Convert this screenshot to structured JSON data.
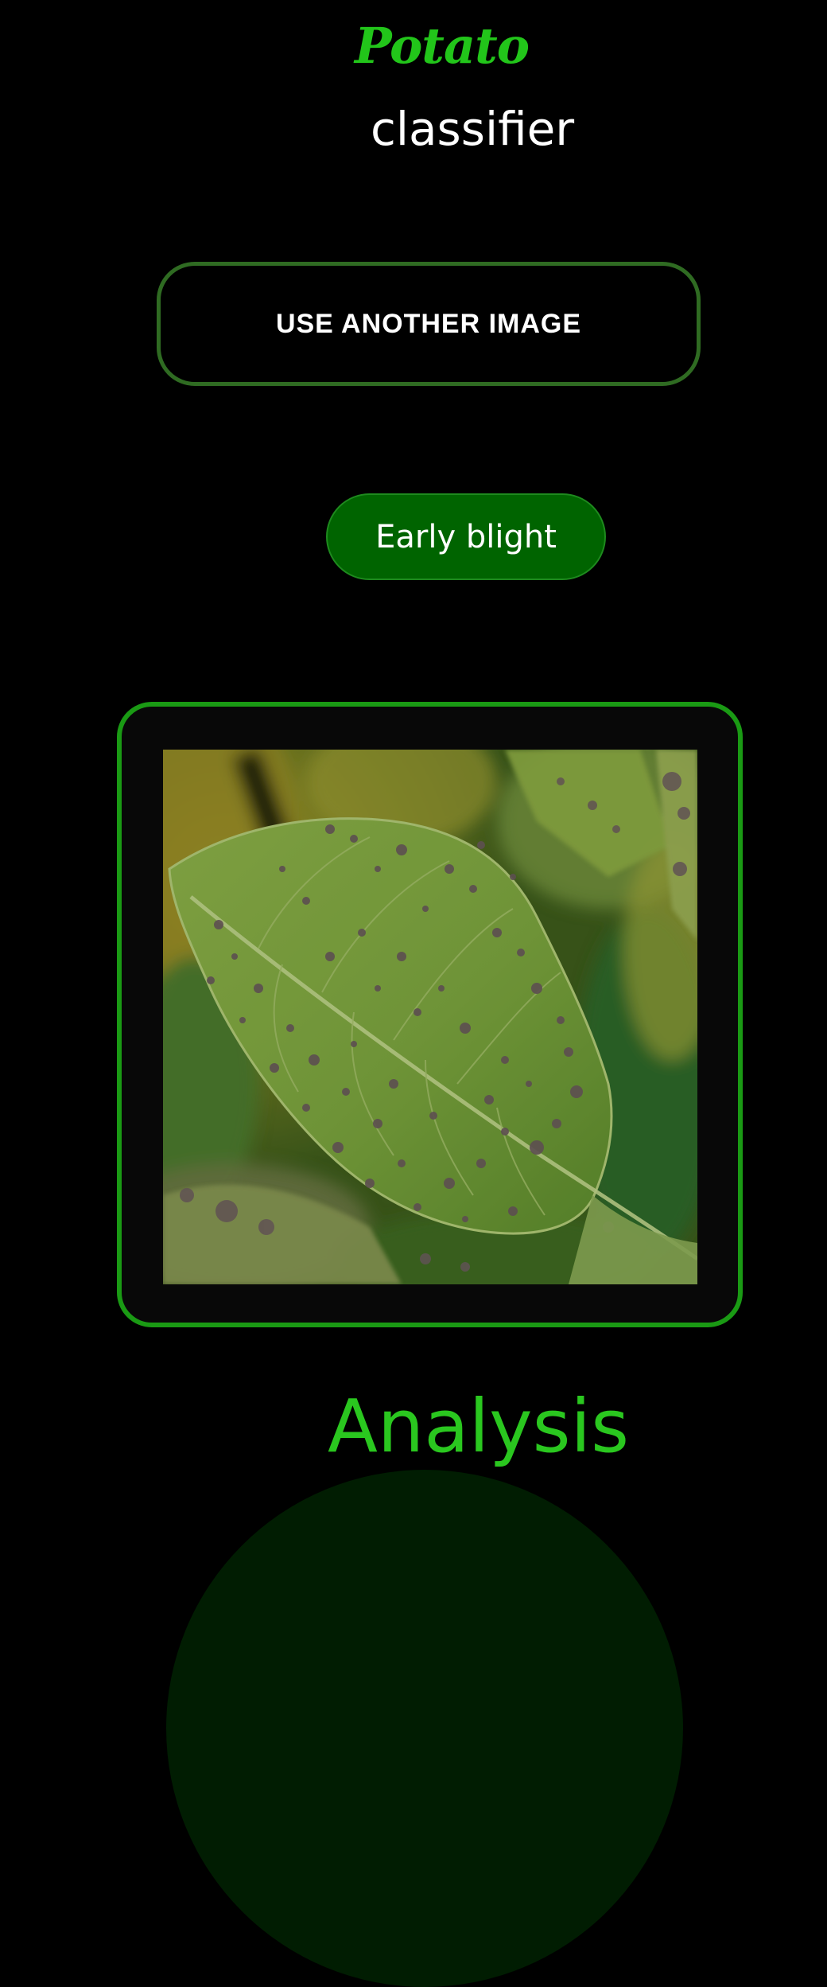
{
  "header": {
    "brand": "Potato",
    "subtitle": "classifier"
  },
  "actions": {
    "use_another_label": "USE ANOTHER IMAGE"
  },
  "prediction": {
    "label": "Early blight"
  },
  "uploaded_image": {
    "alt": "Potato leaf with early blight spots"
  },
  "analysis": {
    "title": "Analysis"
  },
  "colors": {
    "accent": "#22c51a",
    "button_border": "#2f6b22",
    "pill_background": "#006400",
    "frame_border": "#1a9a14",
    "background": "#000000"
  }
}
